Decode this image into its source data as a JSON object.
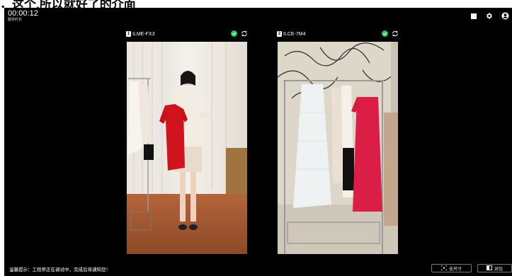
{
  "top_caption": "，这个,所以就好了的介面",
  "session": {
    "time": "00:00:12",
    "label": "服务时长"
  },
  "cameras": [
    {
      "index": "1",
      "name": "ILME-FX3"
    },
    {
      "index": "2",
      "name": "ILCE-7M4"
    }
  ],
  "footer": {
    "tip": "温馨提示：工程师正在调试中，完成后将通知您！",
    "fullsize_label": "全尺寸",
    "compare_label": "对比"
  },
  "colors": {
    "background": "#000000",
    "status_ok": "#22c55e",
    "text": "#ffffff"
  },
  "icons": [
    "stop-icon",
    "settings-gear-icon",
    "user-account-icon",
    "check-circle-icon",
    "switch-camera-icon",
    "fullsize-icon",
    "compare-icon"
  ]
}
